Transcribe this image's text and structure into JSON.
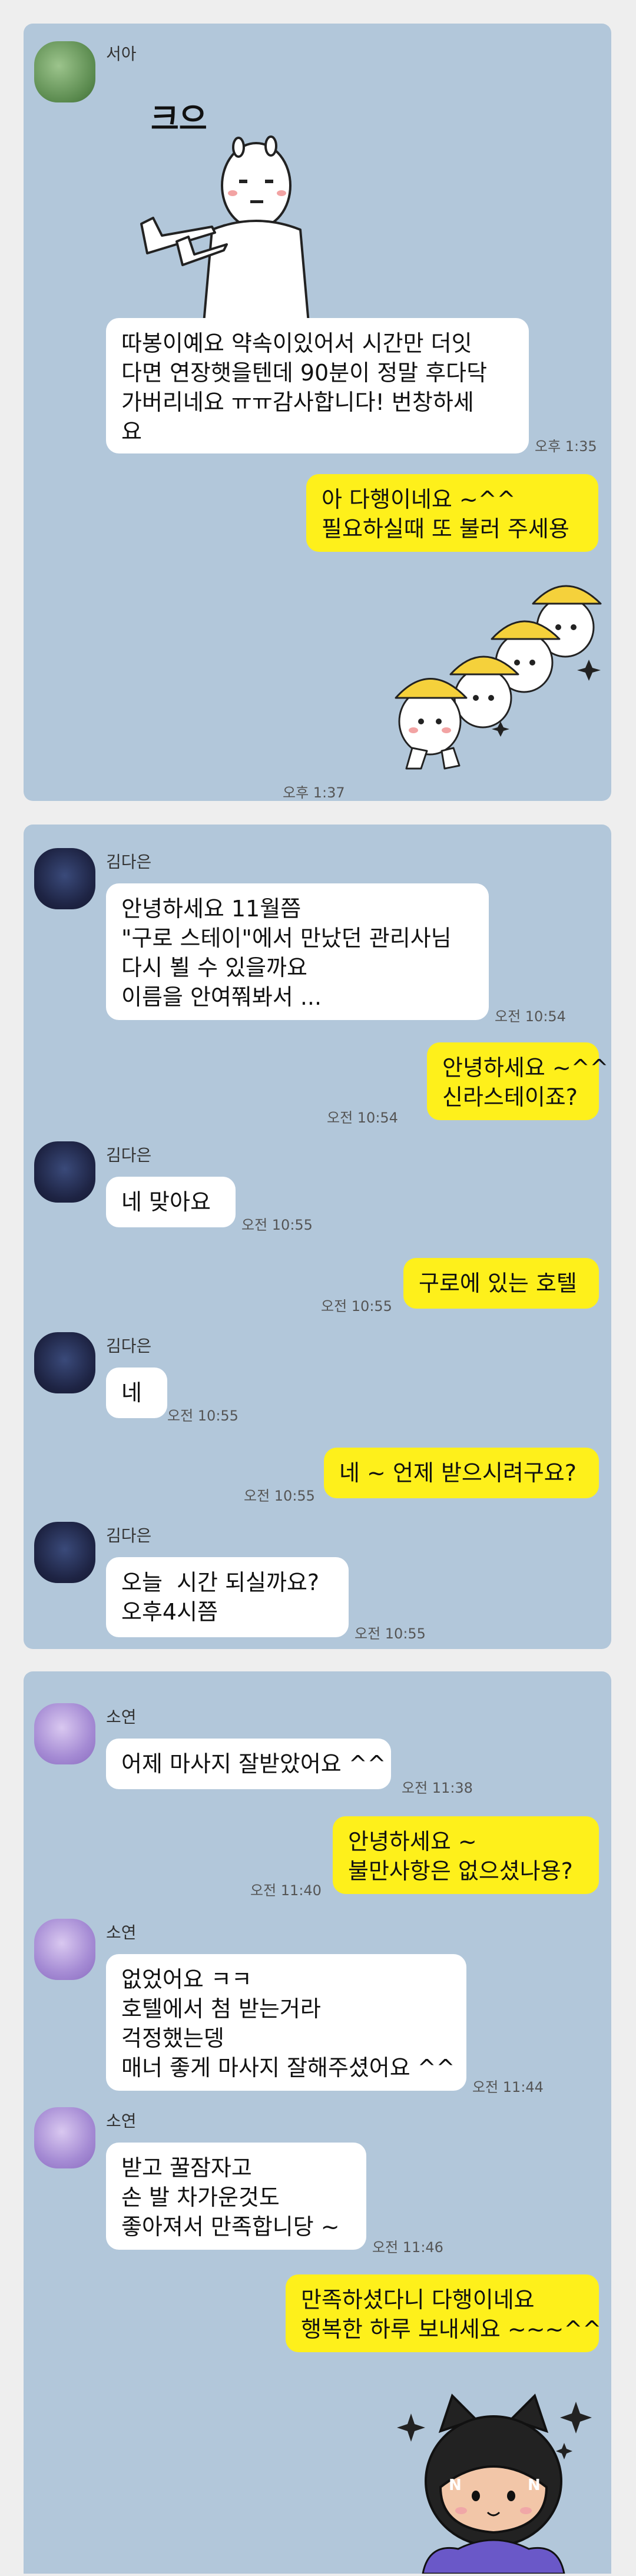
{
  "chat1": {
    "sender": "서아",
    "sticker_text": "크으",
    "msg1": "따봉이예요 약속이있어서 시간만 더잇\n다면 연장햇을텐데 90분이 정말 후다닥\n가버리네요 ㅠㅠ감사합니다! 번창하세\n요",
    "time1": "오후 1:35",
    "reply": "아 다행이네요 ~^^\n필요하실때 또 불러 주세용",
    "sticker_time": "오후 1:37"
  },
  "chat2": {
    "sender": "김다은",
    "msg1": "안녕하세요 11월쯤\n\"구로 스테이\"에서 만났던 관리사님\n다시 뵐 수 있을까요\n이름을 안여쭤봐서 ...",
    "time1": "오전 10:54",
    "reply1": "안녕하세요 ~^^\n신라스테이죠?",
    "reply1_time": "오전 10:54",
    "msg2": "네 맞아요",
    "msg2_time": "오전 10:55",
    "reply2": "구로에 있는 호텔",
    "reply2_time": "오전 10:55",
    "msg3": "네",
    "msg3_time": "오전 10:55",
    "reply3": "네 ~ 언제 받으시려구요?",
    "reply3_time": "오전 10:55",
    "msg4": "오늘  시간 되실까요?\n오후4시쯤",
    "msg4_time": "오전 10:55"
  },
  "chat3": {
    "sender": "소연",
    "msg1": "어제 마사지 잘받았어요 ^^",
    "msg1_time": "오전 11:38",
    "reply1": "안녕하세요 ~\n불만사항은 없으셨나용?",
    "reply1_time": "오전 11:40",
    "msg2": "없었어요 ㅋㅋ\n호텔에서 첨 받는거라\n걱정했는뎅\n매너 좋게 마사지 잘해주셨어요 ^^",
    "msg2_time": "오전 11:44",
    "msg3": "받고 꿀잠자고\n손 발 차가운것도\n좋아져서 만족합니당 ~",
    "msg3_time": "오전 11:46",
    "reply2": "만족하셨다니 다행이네요\n행복한 하루 보내세요 ~~~^^"
  },
  "colors": {
    "chat_bg": "#b2c7da",
    "outgoing_bubble": "#fef01b",
    "incoming_bubble": "#ffffff",
    "page_bg": "#eeeeee"
  }
}
